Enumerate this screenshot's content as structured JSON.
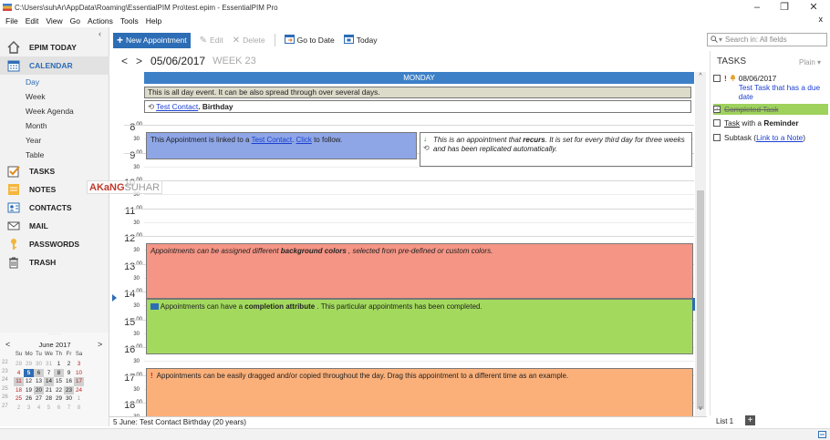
{
  "window": {
    "title": "C:\\Users\\suhAr\\AppData\\Roaming\\EssentialPIM Pro\\test.epim - EssentialPIM Pro",
    "minimize": "–",
    "maximize": "❐",
    "close": "✕",
    "menu_close": "x"
  },
  "menu": [
    "File",
    "Edit",
    "View",
    "Go",
    "Actions",
    "Tools",
    "Help"
  ],
  "nav": {
    "collapse": "‹",
    "items": [
      {
        "label": "EPIM TODAY",
        "icon": "home-icon"
      },
      {
        "label": "CALENDAR",
        "icon": "calendar-icon"
      },
      {
        "label": "TASKS",
        "icon": "check-icon"
      },
      {
        "label": "NOTES",
        "icon": "note-icon"
      },
      {
        "label": "CONTACTS",
        "icon": "contact-card-icon"
      },
      {
        "label": "MAIL",
        "icon": "mail-icon"
      },
      {
        "label": "PASSWORDS",
        "icon": "key-icon"
      },
      {
        "label": "TRASH",
        "icon": "trash-icon"
      }
    ],
    "calendar_views": [
      "Day",
      "Week",
      "Week Agenda",
      "Month",
      "Year",
      "Table"
    ]
  },
  "minical": {
    "month": "June 2017",
    "prev": "<",
    "next": ">",
    "grip": "· · · · ·",
    "dow": [
      "Su",
      "Mo",
      "Tu",
      "We",
      "Th",
      "Fr",
      "Sa"
    ],
    "weeks": [
      "22",
      "23",
      "24",
      "25",
      "26",
      "27"
    ],
    "rows": [
      [
        "28",
        "29",
        "30",
        "31",
        "1",
        "2",
        "3"
      ],
      [
        "4",
        "5",
        "6",
        "7",
        "8",
        "9",
        "10"
      ],
      [
        "11",
        "12",
        "13",
        "14",
        "15",
        "16",
        "17"
      ],
      [
        "18",
        "19",
        "20",
        "21",
        "22",
        "23",
        "24"
      ],
      [
        "25",
        "26",
        "27",
        "28",
        "29",
        "30",
        "1"
      ],
      [
        "2",
        "3",
        "4",
        "5",
        "6",
        "7",
        "8"
      ]
    ]
  },
  "toolbar": {
    "new_appointment": "New Appointment",
    "edit": "Edit",
    "delete": "Delete",
    "go_to_date": "Go to Date",
    "today": "Today"
  },
  "search": {
    "placeholder": "Search in: All fields",
    "dropdown": "▾"
  },
  "calendar": {
    "prev": "<",
    "next": ">",
    "date": "05/06/2017",
    "week": "WEEK 23",
    "day_header": "MONDAY",
    "all_day_event": "This is all day event. It can be also spread through over several days.",
    "birthday_link": "Test Contact",
    "birthday_suffix": ". Birthday",
    "hours": [
      "8",
      "9",
      "10",
      "11",
      "12",
      "13",
      "14",
      "15",
      "16",
      "17",
      "18"
    ],
    "minute_label": "00",
    "half_label": "30",
    "appointments": {
      "linked_prefix": "This Appointment is linked to a ",
      "linked_link": "Test Contact",
      "linked_mid": ". ",
      "linked_click": "Click",
      "linked_suffix": " to follow.",
      "recurring_prefix": "This is an appointment that ",
      "recurring_bold": "recurs",
      "recurring_suffix": ". It is set for every third day for three weeks and has been replicated automatically.",
      "colors_prefix": "Appointments can be assigned different ",
      "colors_bold": "background colors",
      "colors_suffix": " , selected from pre-defined or custom colors.",
      "completed_prefix": "Appointments can have a ",
      "completed_bold": "completion attribute",
      "completed_suffix": " . This particular appointments has been completed.",
      "drag_mark": "!",
      "drag_text": "Appointments can be easily dragged and/or copied throughout the day. Drag this appointment to a different time as an example."
    },
    "status": "5 June:  Test Contact Birthday  (20 years)",
    "colors": {
      "header": "#3d80c8",
      "linked": "#8ea6e6",
      "colored": "#f59585",
      "completed": "#a3da5e",
      "drag": "#fbb07a"
    }
  },
  "tasks": {
    "title": "TASKS",
    "view": "Plain ▾",
    "items": [
      {
        "date": "08/06/2017",
        "title": "Test Task that has a due date"
      },
      {
        "title": "Completed Task"
      },
      {
        "link": "Task",
        "mid": " with a ",
        "bold": "Reminder"
      },
      {
        "prefix": "Subtask (",
        "link": "Link to a Note",
        "suffix": ")"
      }
    ],
    "list_tab": "List 1",
    "add": "+"
  },
  "watermark": {
    "k": "AKaNG",
    "s": "SUHAR"
  }
}
